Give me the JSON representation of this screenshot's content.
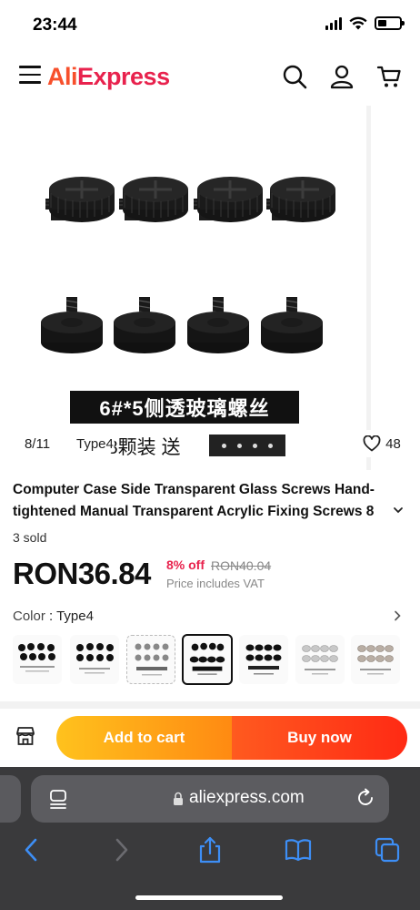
{
  "status_bar": {
    "time": "23:44"
  },
  "header": {
    "logo_part1": "Ali",
    "logo_part2": "Express",
    "menu_icon": "hamburger-menu-icon",
    "search_icon": "search-icon",
    "account_icon": "user-icon",
    "cart_icon": "cart-icon"
  },
  "gallery": {
    "image_text_line1": "6#*5侧透玻璃螺丝",
    "image_text_line2": "8颗装 送",
    "counter": "8/11",
    "variant_tag": "Type4",
    "wishlist_count": "48"
  },
  "product": {
    "title": "Computer Case Side Transparent Glass Screws Hand-tightened Manual Transparent Acrylic Fixing Screws 8",
    "sold": "3 sold",
    "price": "RON36.84",
    "discount": "8% off",
    "original_price": "RON40.04",
    "vat_note": "Price includes VAT",
    "color_label": "Color",
    "color_separator": " : ",
    "color_value": "Type4",
    "selected_thumb_index": 3,
    "thumbnail_count": 7
  },
  "actions": {
    "add_to_cart": "Add to cart",
    "buy_now": "Buy now",
    "store_icon": "store-icon"
  },
  "browser": {
    "url": "aliexpress.com"
  },
  "colors": {
    "brand_orange": "#f7502c",
    "brand_red": "#e8224d",
    "cart_button": "#ffa41a",
    "buy_button": "#ff3c1a",
    "safari_bar": "#3a3a3c",
    "safari_blue": "#3d8ef5"
  }
}
